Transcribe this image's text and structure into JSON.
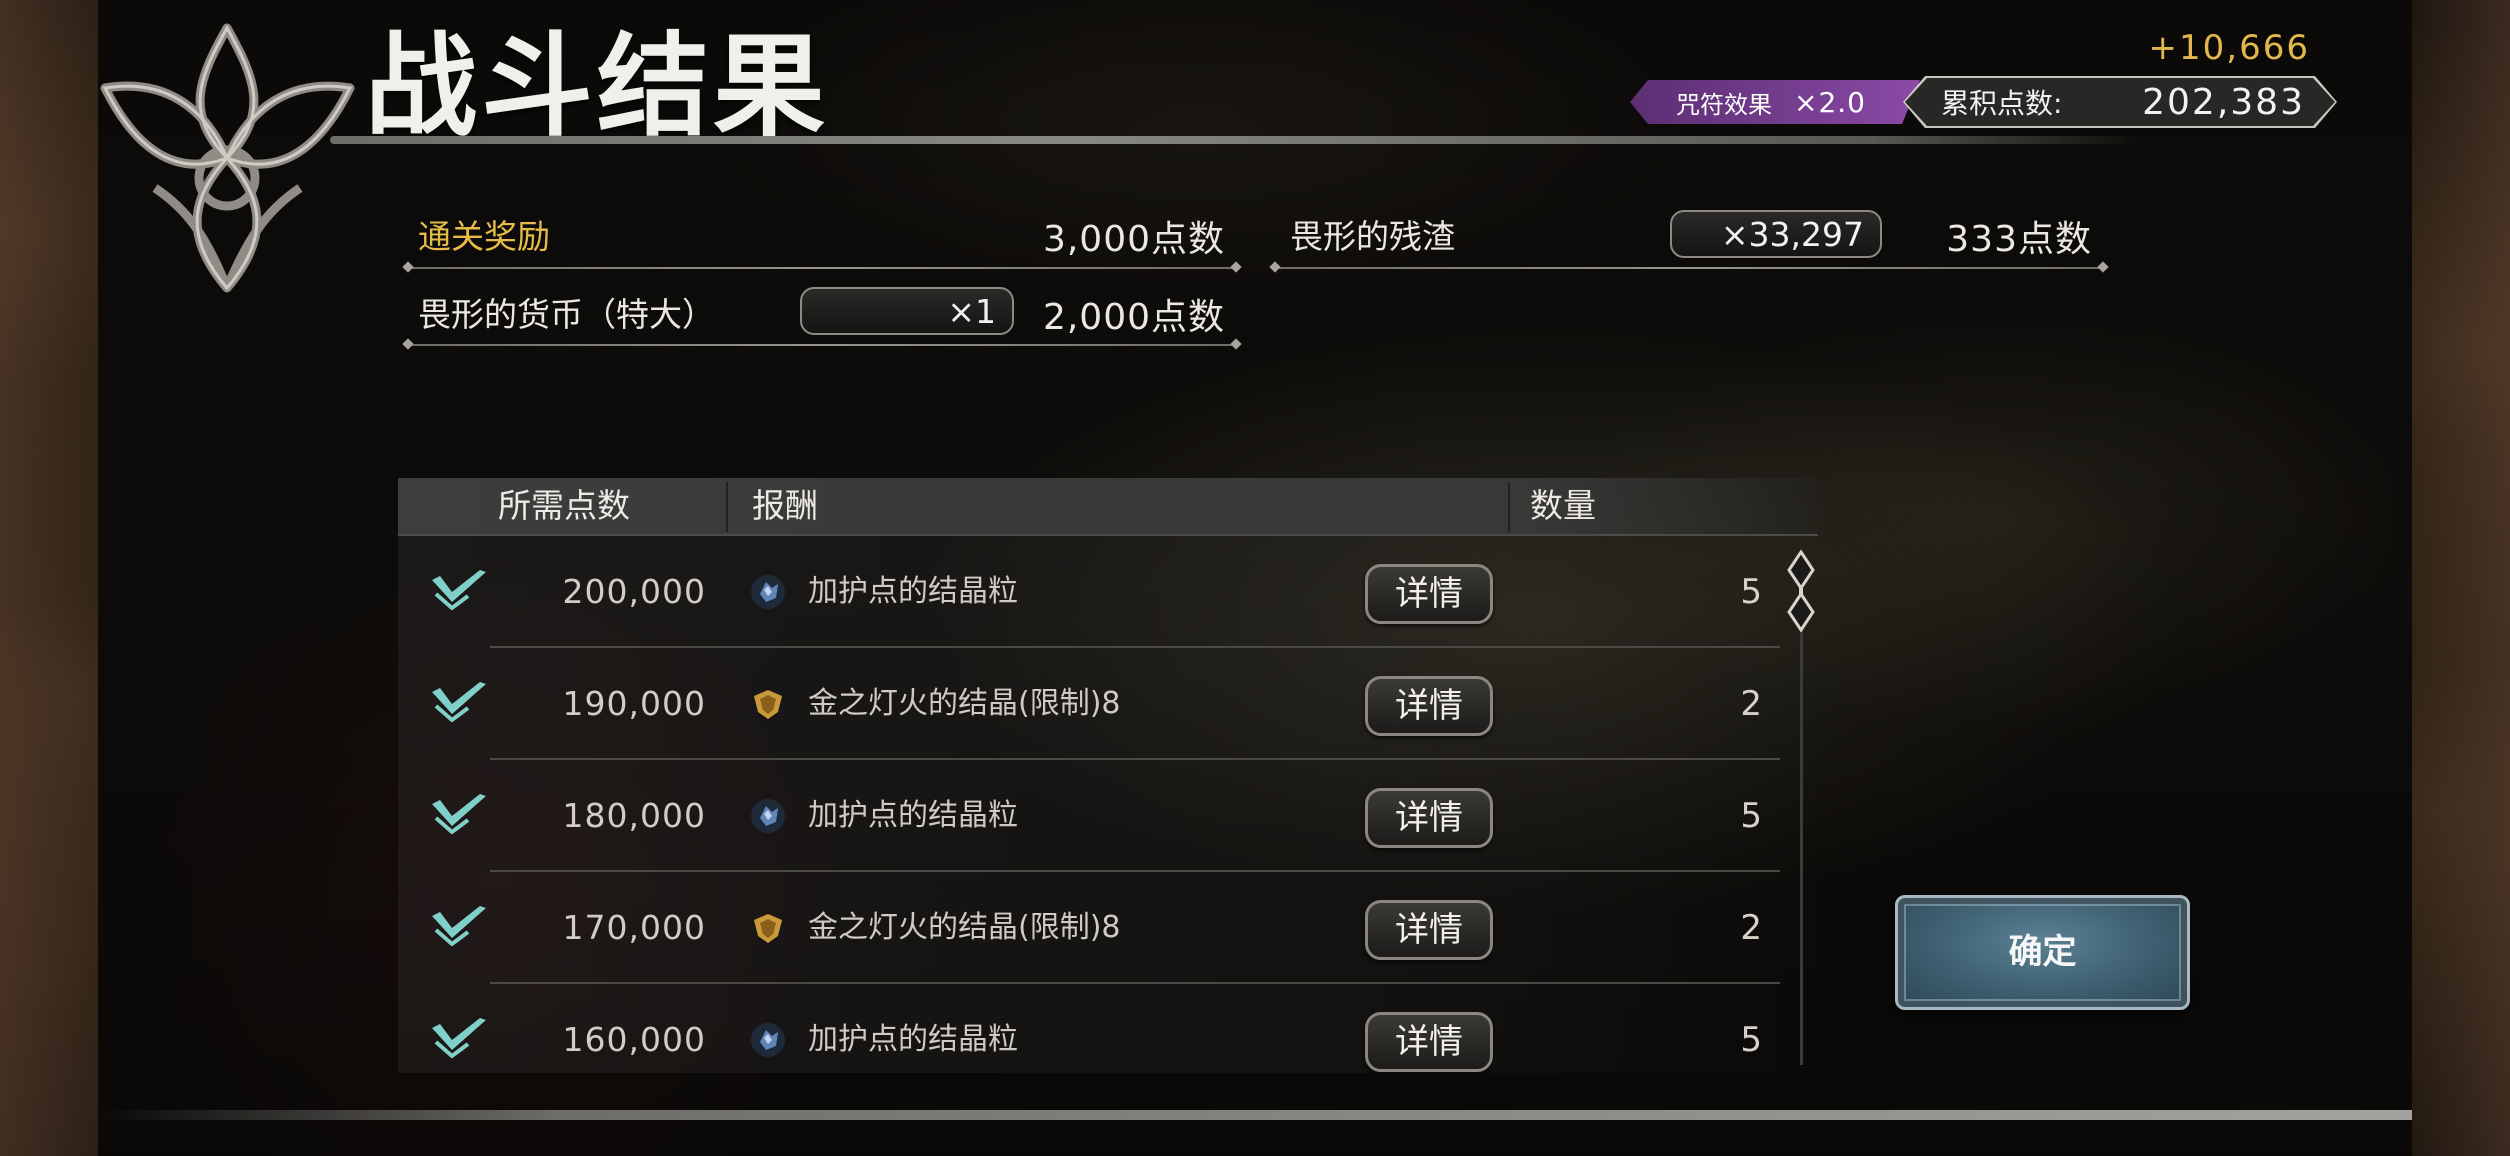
{
  "header": {
    "title": "战斗结果",
    "bonus_total": "+10,666",
    "charm_label": "咒符效果",
    "charm_multiplier": "×2.0",
    "accum_label": "累积点数:",
    "accum_value": "202,383"
  },
  "rewards": {
    "clear": {
      "label": "通关奖励",
      "points": "3,000点数"
    },
    "remnant": {
      "label": "畏形的残渣",
      "qty": "×33,297",
      "points": "333点数"
    },
    "coin": {
      "label": "畏形的货币（特大）",
      "qty": "×1",
      "points": "2,000点数"
    }
  },
  "table": {
    "headers": {
      "required": "所需点数",
      "reward": "报酬",
      "quantity": "数量"
    },
    "detail_label": "详情",
    "rows": [
      {
        "points": "200,000",
        "icon": "blue-crystal-icon",
        "name": "加护点的结晶粒",
        "count": "5"
      },
      {
        "points": "190,000",
        "icon": "gold-shield-icon",
        "name": "金之灯火的结晶(限制)8",
        "count": "2"
      },
      {
        "points": "180,000",
        "icon": "blue-crystal-icon",
        "name": "加护点的结晶粒",
        "count": "5"
      },
      {
        "points": "170,000",
        "icon": "gold-shield-icon",
        "name": "金之灯火的结晶(限制)8",
        "count": "2"
      },
      {
        "points": "160,000",
        "icon": "blue-crystal-icon",
        "name": "加护点的结晶粒",
        "count": "5"
      }
    ]
  },
  "confirm_label": "确定",
  "colors": {
    "accent_gold": "#e6bb47",
    "charm_purple": "#8a4aa6",
    "confirm_blue": "#3d5f70",
    "check_teal": "#7fd0c8"
  }
}
